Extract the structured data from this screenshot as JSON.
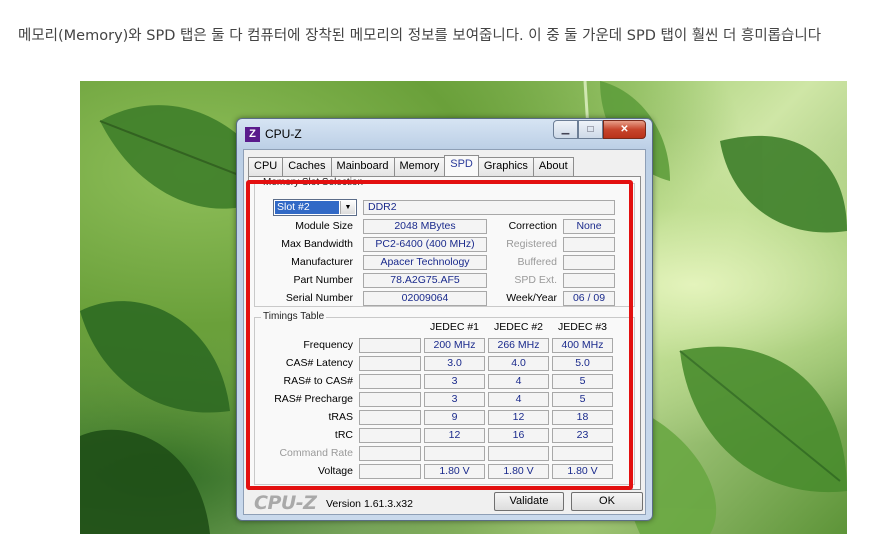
{
  "caption": "메모리(Memory)와 SPD 탭은 둘 다 컴퓨터에 장착된 메모리의 정보를 보여줍니다. 이 중 둘 가운데 SPD 탭이 훨씬 더 흥미롭습니다",
  "window": {
    "title": "CPU-Z",
    "icon_letter": "Z",
    "min_label": "▁",
    "max_label": "□",
    "close_label": "✕"
  },
  "tabs": [
    "CPU",
    "Caches",
    "Mainboard",
    "Memory",
    "SPD",
    "Graphics",
    "About"
  ],
  "active_tab": "SPD",
  "slot_group": {
    "label": "Memory Slot Selection",
    "slot_selected": "Slot #2",
    "memory_type": "DDR2",
    "rows": [
      {
        "label": "Module Size",
        "value": "2048 MBytes",
        "right_label": "Correction",
        "right_value": "None",
        "right_dim": false
      },
      {
        "label": "Max Bandwidth",
        "value": "PC2-6400 (400 MHz)",
        "right_label": "Registered",
        "right_value": "",
        "right_dim": true
      },
      {
        "label": "Manufacturer",
        "value": "Apacer Technology",
        "right_label": "Buffered",
        "right_value": "",
        "right_dim": true
      },
      {
        "label": "Part Number",
        "value": "78.A2G75.AF5",
        "right_label": "SPD Ext.",
        "right_value": "",
        "right_dim": true
      },
      {
        "label": "Serial Number",
        "value": "02009064",
        "right_label": "Week/Year",
        "right_value": "06 / 09",
        "right_dim": false
      }
    ]
  },
  "timings": {
    "label": "Timings Table",
    "columns": [
      "JEDEC #1",
      "JEDEC #2",
      "JEDEC #3"
    ],
    "rows": [
      {
        "label": "Frequency",
        "values": [
          "200 MHz",
          "266 MHz",
          "400 MHz"
        ],
        "dim": false
      },
      {
        "label": "CAS# Latency",
        "values": [
          "3.0",
          "4.0",
          "5.0"
        ],
        "dim": false
      },
      {
        "label": "RAS# to CAS#",
        "values": [
          "3",
          "4",
          "5"
        ],
        "dim": false
      },
      {
        "label": "RAS# Precharge",
        "values": [
          "3",
          "4",
          "5"
        ],
        "dim": false
      },
      {
        "label": "tRAS",
        "values": [
          "9",
          "12",
          "18"
        ],
        "dim": false
      },
      {
        "label": "tRC",
        "values": [
          "12",
          "16",
          "23"
        ],
        "dim": false
      },
      {
        "label": "Command Rate",
        "values": [
          "",
          "",
          ""
        ],
        "dim": true
      },
      {
        "label": "Voltage",
        "values": [
          "1.80 V",
          "1.80 V",
          "1.80 V"
        ],
        "dim": false
      }
    ]
  },
  "footer": {
    "brand": "CPU-Z",
    "version": "Version 1.61.3.x32",
    "validate_label": "Validate",
    "ok_label": "OK"
  },
  "colors": {
    "highlight": "#e31010",
    "value_text": "#1a2a8c",
    "icon_bg": "#5a1b8c"
  }
}
